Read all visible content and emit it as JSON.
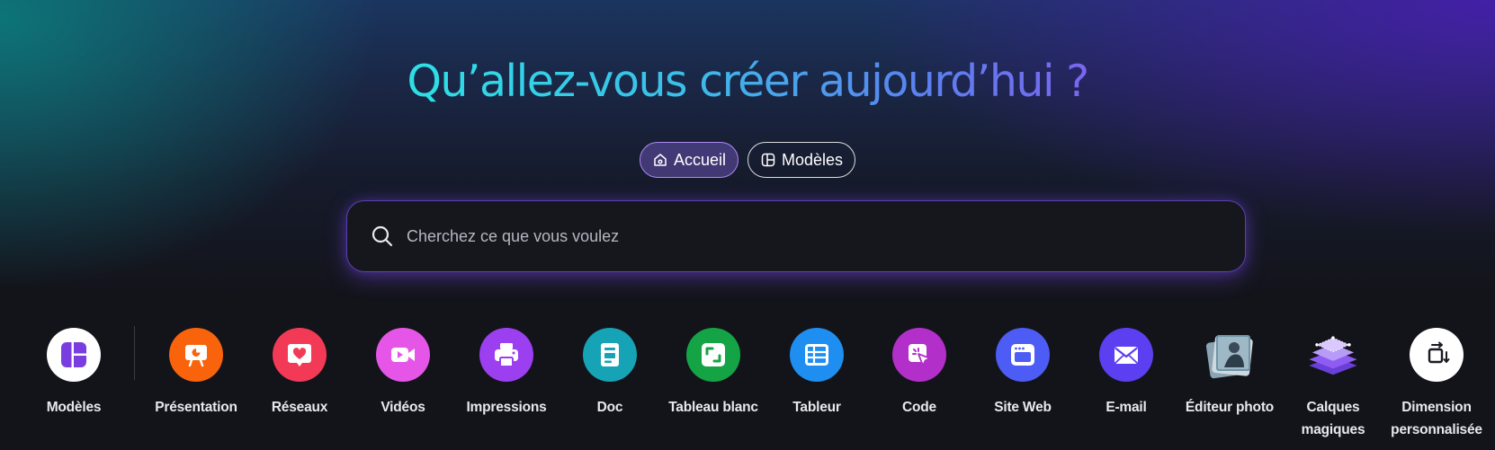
{
  "header": {
    "title": "Qu’allez-vous créer aujourd’hui ?"
  },
  "tabs": [
    {
      "label": "Accueil",
      "icon": "home-icon",
      "active": true
    },
    {
      "label": "Modèles",
      "icon": "template-icon",
      "active": false
    }
  ],
  "search": {
    "placeholder": "Cherchez ce que vous voulez",
    "value": ""
  },
  "categories": [
    {
      "label": "Modèles",
      "icon": "templates-icon",
      "color": "#ffffff"
    },
    {
      "label": "Présentation",
      "icon": "presentation-icon",
      "color": "#f9630b"
    },
    {
      "label": "Réseaux",
      "icon": "heart-chat-icon",
      "color": "#f23a56"
    },
    {
      "label": "Vidéos",
      "icon": "video-camera-icon",
      "color": "#e455e8"
    },
    {
      "label": "Impressions",
      "icon": "printer-icon",
      "color": "#9b3ff0"
    },
    {
      "label": "Doc",
      "icon": "document-icon",
      "color": "#16a3b5"
    },
    {
      "label": "Tableau blanc",
      "icon": "whiteboard-icon",
      "color": "#14a446"
    },
    {
      "label": "Tableur",
      "icon": "spreadsheet-icon",
      "color": "#1e8ef0"
    },
    {
      "label": "Code",
      "icon": "code-cursor-icon",
      "color": "#b22fc9"
    },
    {
      "label": "Site Web",
      "icon": "browser-window-icon",
      "color": "#4d5cf5"
    },
    {
      "label": "E-mail",
      "icon": "envelope-icon",
      "color": "#5b3ff0"
    },
    {
      "label": "Éditeur photo",
      "icon": "photo-editor-icon",
      "color": ""
    },
    {
      "label": "Calques magiques",
      "icon": "magic-layers-icon",
      "color": ""
    },
    {
      "label": "Dimension personnalisée",
      "icon": "custom-size-icon",
      "color": "#ffffff"
    }
  ]
}
